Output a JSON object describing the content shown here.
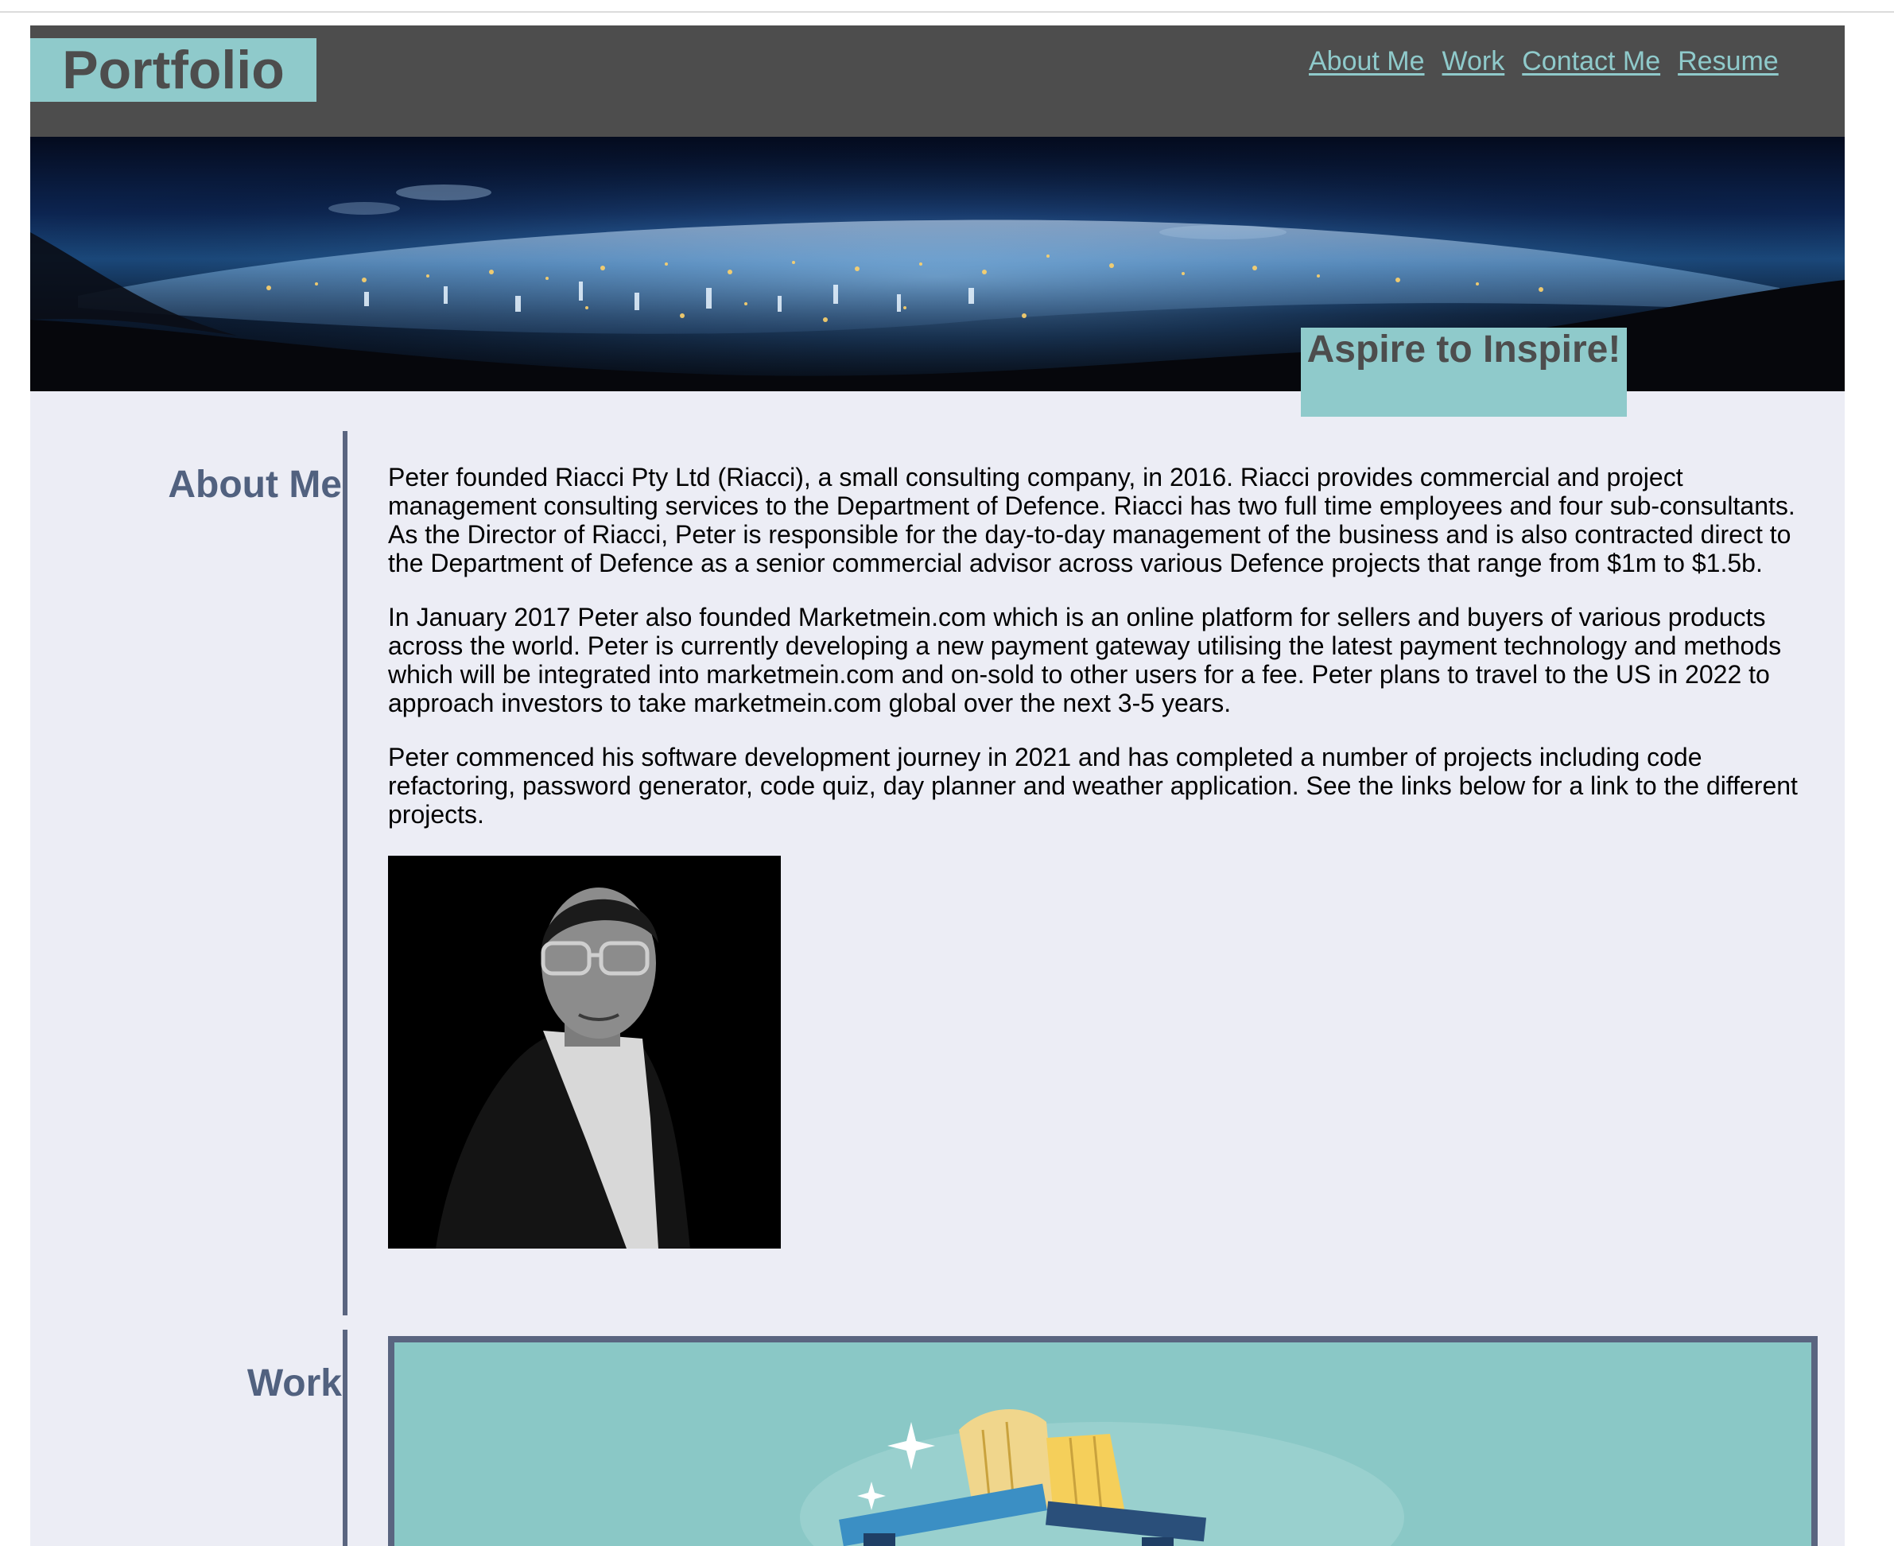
{
  "header": {
    "logo": "Portfolio",
    "nav": [
      "About Me",
      "Work",
      "Contact Me",
      "Resume"
    ]
  },
  "hero": {
    "tagline": "Aspire to Inspire!"
  },
  "about": {
    "title": "About Me",
    "paragraphs": [
      "Peter founded Riacci Pty Ltd (Riacci), a small consulting company, in 2016. Riacci provides commercial and project management consulting services to the Department of Defence. Riacci has two full time employees and four sub-consultants. As the Director of Riacci, Peter is responsible for the day-to-day management of the business and is also contracted direct to the Department of Defence as a senior commercial advisor across various Defence projects that range from $1m to $1.5b.",
      "In January 2017 Peter also founded Marketmein.com which is an online platform for sellers and buyers of various products across the world. Peter is currently developing a new payment gateway utilising the latest payment technology and methods which will be integrated into marketmein.com and on-sold to other users for a fee. Peter plans to travel to the US in 2022 to approach investors to take marketmein.com global over the next 3-5 years.",
      "Peter commenced his software development journey in 2021 and has completed a number of projects including code refactoring, password generator, code quiz, day planner and weather application. See the links below for a link to the different projects."
    ]
  },
  "work": {
    "title": "Work"
  },
  "colors": {
    "header_bg": "#4d4d4d",
    "accent_teal": "#8fcacb",
    "page_bg": "#ecedf5",
    "heading_slate": "#51617f",
    "divider": "#5a6580"
  }
}
